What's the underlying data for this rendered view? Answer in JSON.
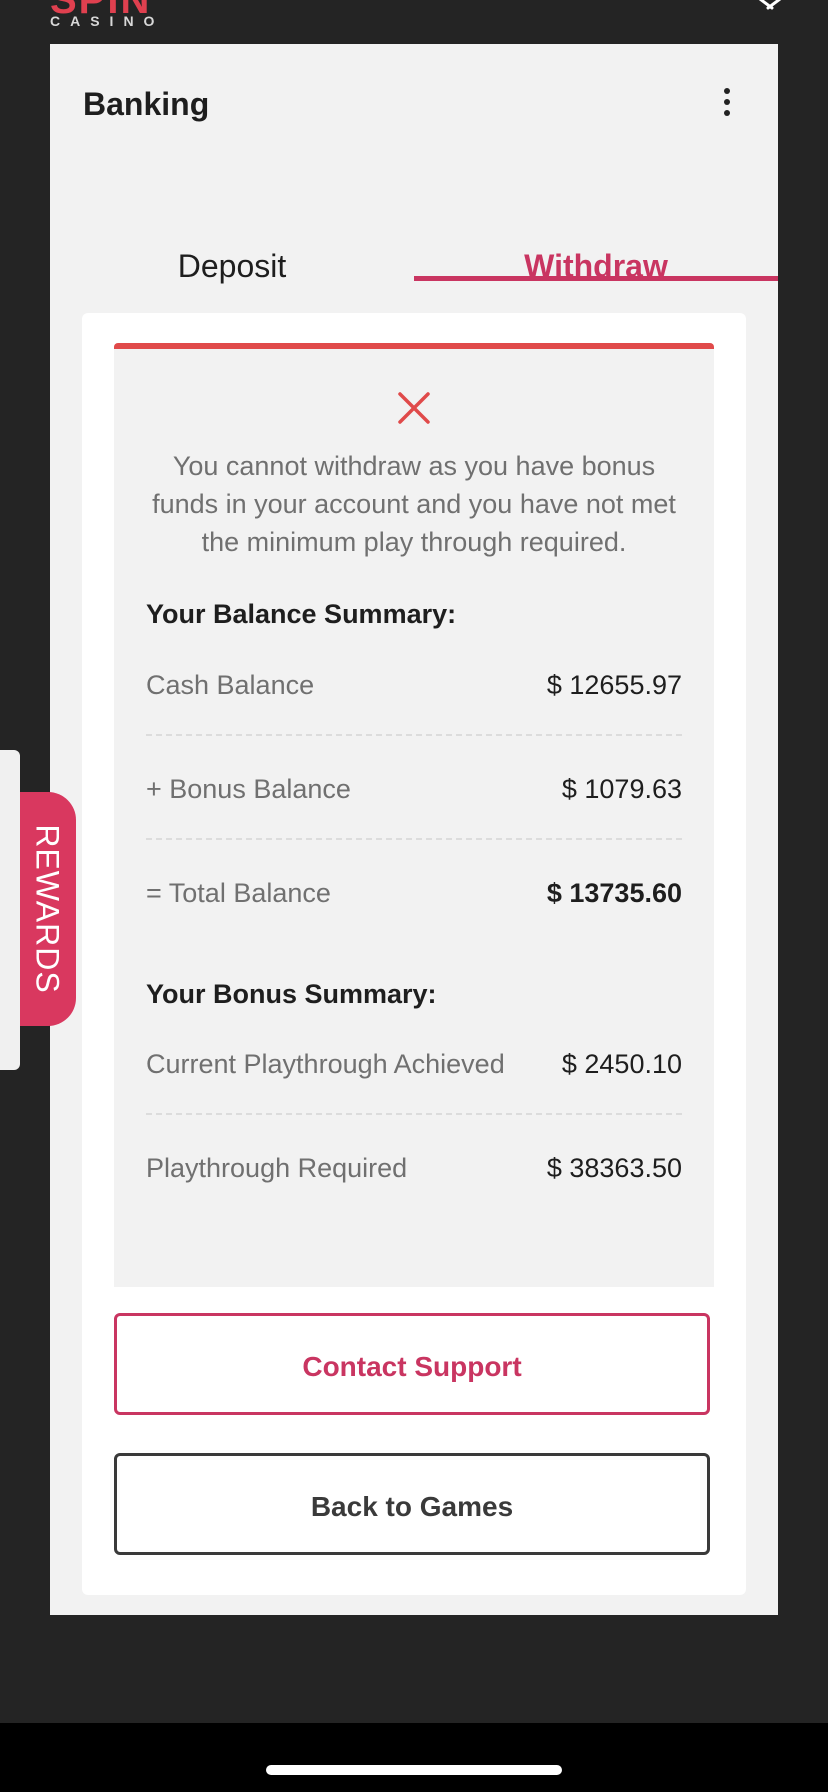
{
  "brand": {
    "name": "SPIN",
    "sub": "CASINO",
    "accent_color": "#c93561",
    "error_color": "#e04a4a"
  },
  "header": {
    "title": "Banking",
    "menu_icon": "kebab-menu-icon",
    "close_icon": "close-icon"
  },
  "tabs": [
    {
      "label": "Deposit",
      "active": false
    },
    {
      "label": "Withdraw",
      "active": true
    }
  ],
  "notice": {
    "icon": "error-x-icon",
    "message": "You cannot withdraw as you have bonus funds in your account and you have not met the minimum play through required."
  },
  "balance_summary": {
    "title": "Your Balance Summary:",
    "rows": [
      {
        "label": "Cash Balance",
        "value": "$ 12655.97"
      },
      {
        "label": "+ Bonus Balance",
        "value": "$ 1079.63"
      },
      {
        "label": "= Total Balance",
        "value": "$ 13735.60"
      }
    ]
  },
  "bonus_summary": {
    "title": "Your Bonus Summary:",
    "rows": [
      {
        "label": "Current Playthrough Achieved",
        "value": "$ 2450.10"
      },
      {
        "label": "Playthrough Required",
        "value": "$ 38363.50"
      }
    ]
  },
  "buttons": {
    "contact_support": "Contact Support",
    "back_to_games": "Back to Games"
  },
  "rewards": {
    "label": "REWARDS"
  }
}
